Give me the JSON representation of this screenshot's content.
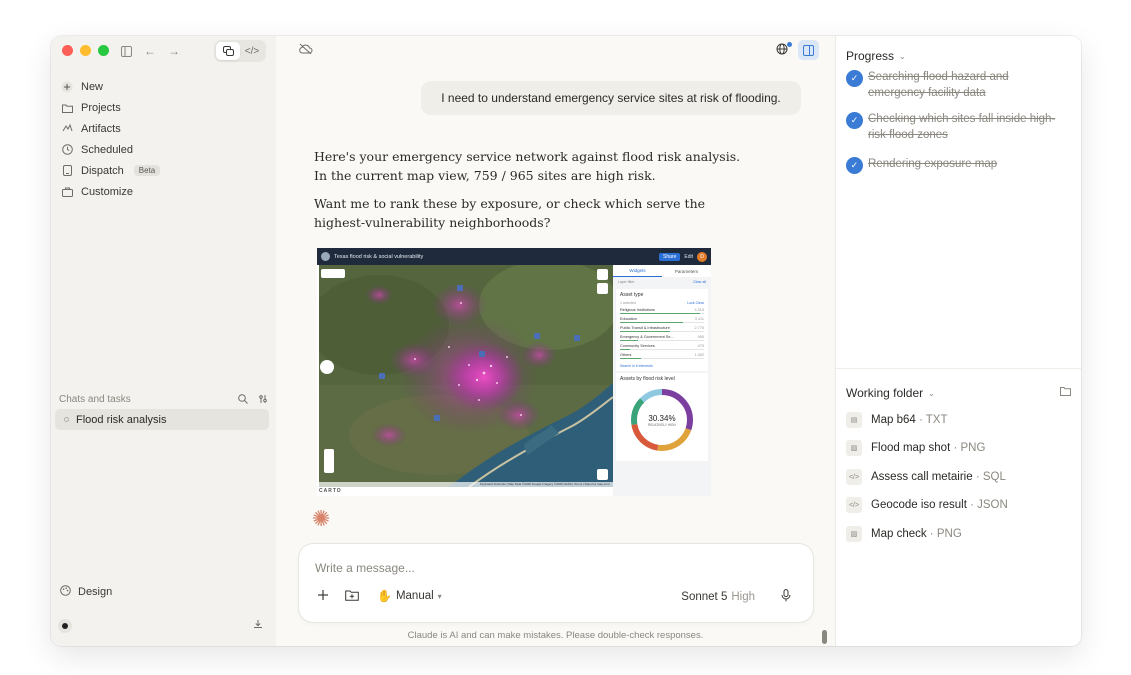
{
  "sidebar": {
    "nav": [
      {
        "label": "New",
        "icon": "plus-icon"
      },
      {
        "label": "Projects",
        "icon": "folder-icon"
      },
      {
        "label": "Artifacts",
        "icon": "artifacts-icon"
      },
      {
        "label": "Scheduled",
        "icon": "clock-icon"
      },
      {
        "label": "Dispatch",
        "icon": "phone-icon",
        "badge": "Beta"
      },
      {
        "label": "Customize",
        "icon": "briefcase-icon"
      }
    ],
    "chats_heading": "Chats and tasks",
    "chats": [
      {
        "label": "Flood risk analysis"
      }
    ],
    "design_label": "Design"
  },
  "conversation": {
    "user_message": "I need to understand emergency service sites at risk of flooding.",
    "reply_paragraph_1": "Here's your emergency service network against flood risk analysis. In the current map view, 759 / 965 sites are high risk.",
    "reply_paragraph_2": "Want me to rank these by exposure, or check which serve the highest-vulnerability neighborhoods?"
  },
  "map_image": {
    "title": "Texas flood risk & social vulnerability",
    "share_label": "Share",
    "edit_label": "Edit",
    "user_initial": "D",
    "tabs": [
      "Widgets",
      "Parameters"
    ],
    "layer_filter_label": "Layer filter",
    "clear_label": "Clear all",
    "asset_type": {
      "title": "Asset type",
      "subheader": "1 selected",
      "actions": "Lock   Clear",
      "rows": [
        {
          "label": "Religious Institutions",
          "count": "4,315",
          "fill": 0.95
        },
        {
          "label": "Education",
          "count": "3,411",
          "fill": 0.75
        },
        {
          "label": "Public Transit & Infrastructure",
          "count": "2,775",
          "fill": 0.6
        },
        {
          "label": "Emergency & Government Se...",
          "count": "965",
          "fill": 0.22
        },
        {
          "label": "Community Services",
          "count": "475",
          "fill": 0.12
        },
        {
          "label": "Others",
          "count": "1,062",
          "fill": 0.25
        }
      ],
      "search_link": "Search in 6 elements"
    },
    "risk_level": {
      "title": "Assets by flood risk level",
      "percent": "30.34%",
      "percent_label": "RELATIVELY HIGH",
      "segments": [
        {
          "value": 30.34,
          "color": "#7b3fa0"
        },
        {
          "value": 22,
          "color": "#e0a23a"
        },
        {
          "value": 20,
          "color": "#d85a3a"
        },
        {
          "value": 15,
          "color": "#3aa37a"
        },
        {
          "value": 12.66,
          "color": "#8fc9e0"
        }
      ]
    },
    "attribution": "Keyboard shortcuts | Map Data ©2026 Google Imagery ©2026 NASA | Terms | Report a map error",
    "carto": "CARTO"
  },
  "composer": {
    "placeholder": "Write a message...",
    "mode_label": "Manual",
    "model": "Sonnet 5",
    "effort": "High"
  },
  "disclaimer": "Claude is AI and can make mistakes. Please double-check responses.",
  "progress": {
    "title": "Progress",
    "steps": [
      {
        "text": "Searching flood hazard and emergency facility data"
      },
      {
        "text": "Checking which sites fall inside high-risk flood zones"
      },
      {
        "text": "Rendering exposure map"
      }
    ]
  },
  "working_folder": {
    "title": "Working folder",
    "files": [
      {
        "name": "Map b64",
        "ext": "TXT",
        "icon": "document-icon"
      },
      {
        "name": "Flood map shot",
        "ext": "PNG",
        "icon": "image-icon"
      },
      {
        "name": "Assess call metairie",
        "ext": "SQL",
        "icon": "code-icon"
      },
      {
        "name": "Geocode iso result",
        "ext": "JSON",
        "icon": "code-icon"
      },
      {
        "name": "Map check",
        "ext": "PNG",
        "icon": "image-icon"
      }
    ]
  },
  "colors": {
    "accent": "#3a7bd5",
    "traffic_red": "#ff5f57",
    "traffic_yellow": "#febc2e",
    "traffic_green": "#28c840",
    "spark": "#d9846a"
  }
}
